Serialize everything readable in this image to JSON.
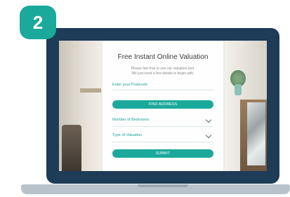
{
  "badge": {
    "number": "2"
  },
  "form": {
    "title": "Free Instant Online Valuation",
    "subtitle_line1": "Please feel free to use our valuation tool.",
    "subtitle_line2": "We just need a few details to begin with.",
    "postcode_label": "Enter your Postcode",
    "find_address_label": "FIND ADDRESS",
    "bedrooms_label": "Number of Bedrooms",
    "valuation_type_label": "Type of Valuation",
    "submit_label": "SUBMIT"
  },
  "colors": {
    "accent": "#1ba99c",
    "laptop_frame": "#1e3b57",
    "laptop_base": "#b9c3cb"
  }
}
